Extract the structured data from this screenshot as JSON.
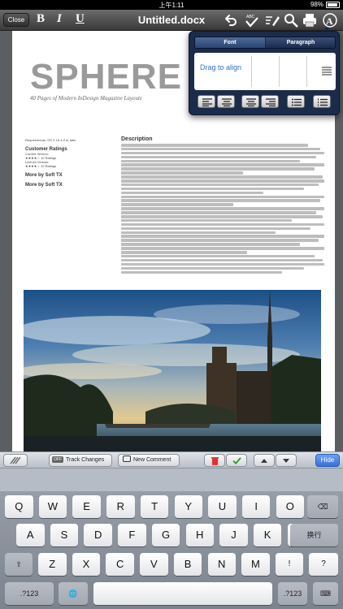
{
  "status_bar": {
    "time": "上午1:11",
    "battery": "98%"
  },
  "toolbar": {
    "close_label": "Close",
    "bold_label": "B",
    "italic_label": "I",
    "underline_label": "U",
    "document_title": "Untitled.docx",
    "icons": [
      "undo-icon",
      "spellcheck-icon",
      "edit-icon",
      "search-icon",
      "print-icon",
      "format-icon"
    ]
  },
  "document": {
    "magazine_title": "SPHERE",
    "magazine_subtitle": "40 Pages of Modern InDesign Magazine Layouts",
    "requirements": "Requirements: OS X 10.4.0 or later",
    "customer_ratings_heading": "Customer Ratings",
    "current_version_label": "Current Version:",
    "current_version_ratings": "★★★★☆ 10 Ratings",
    "all_versions_label": "Lizenzh Version:",
    "all_versions_ratings": "★★★★☆ 10 Ratings",
    "more_by_1": "More by Soft TX",
    "more_by_2": "More by Soft TX",
    "description_heading": "Description"
  },
  "popover": {
    "tabs": [
      "Font",
      "Paragraph"
    ],
    "active_tab": "Font",
    "drag_text": "Drag to align",
    "align_buttons": [
      "align-left-icon",
      "align-center-icon",
      "align-right-icon",
      "align-justify-icon",
      "bullet-list-icon",
      "numbered-list-icon"
    ]
  },
  "edit_bar": {
    "off_label": "OFF",
    "track_changes_label": "Track Changes",
    "new_comment_label": "New Comment",
    "hide_label": "Hide"
  },
  "keyboard": {
    "row1": [
      "Q",
      "W",
      "E",
      "R",
      "T",
      "Y",
      "U",
      "I",
      "O",
      "P"
    ],
    "row2": [
      "A",
      "S",
      "D",
      "F",
      "G",
      "H",
      "J",
      "K",
      "L"
    ],
    "row3": [
      "Z",
      "X",
      "C",
      "V",
      "B",
      "N",
      "M",
      "!",
      "?"
    ],
    "row3_punct": [
      ",",
      "."
    ],
    "return_label": "换行",
    "numbers_label": ".?123",
    "shift_label": "⇧",
    "globe_label": "🌐",
    "delete_label": "⌫",
    "hide_keyboard_label": "⌨"
  },
  "colors": {
    "toolbar": "#4a4a4a",
    "popover": "#1b2b4a",
    "accent_blue": "#3a70d6",
    "drag_text": "#2f6fd0"
  }
}
